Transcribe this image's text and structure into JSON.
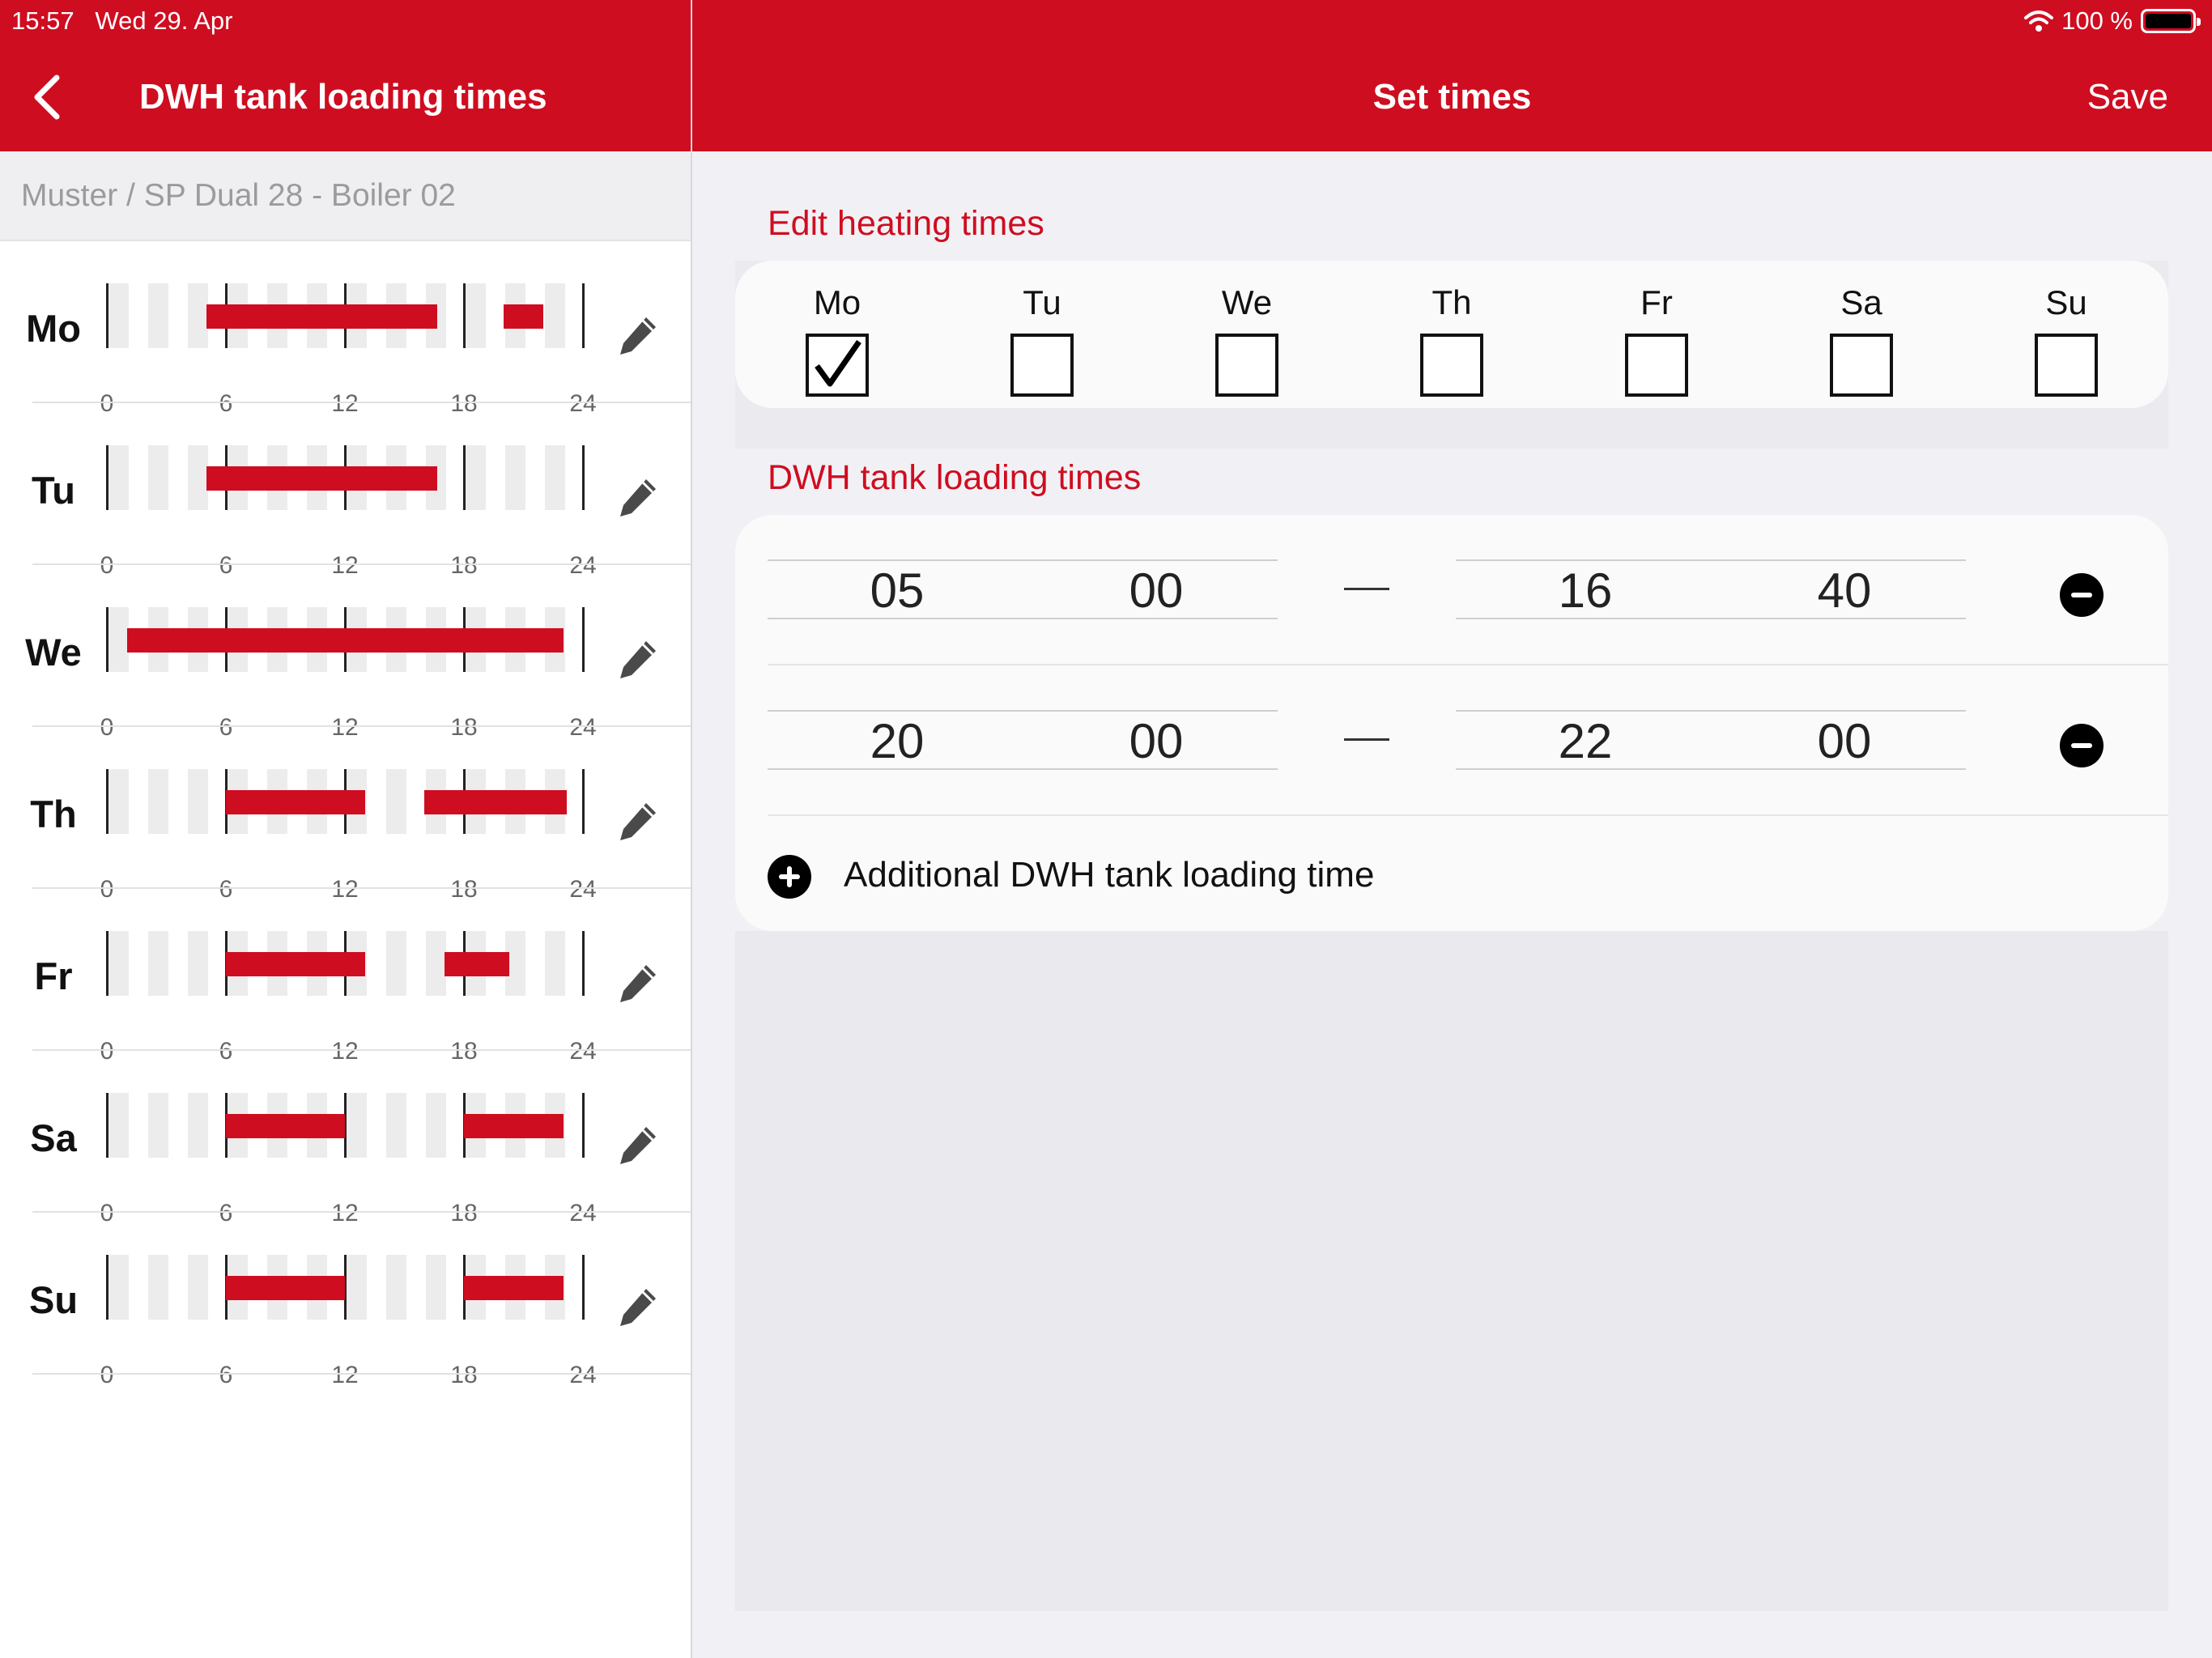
{
  "status_bar": {
    "time": "15:57",
    "date": "Wed 29. Apr",
    "battery": "100 %"
  },
  "left_header": {
    "title": "DWH tank loading times"
  },
  "right_header": {
    "title": "Set times",
    "save_label": "Save"
  },
  "breadcrumb": "Muster / SP Dual 28 - Boiler 02",
  "tick_labels": [
    "0",
    "6",
    "12",
    "18",
    "24"
  ],
  "schedule": [
    {
      "day": "Mo",
      "bars": [
        [
          5,
          16.67
        ],
        [
          20,
          22
        ]
      ]
    },
    {
      "day": "Tu",
      "bars": [
        [
          5,
          16.67
        ]
      ]
    },
    {
      "day": "We",
      "bars": [
        [
          1,
          23
        ]
      ]
    },
    {
      "day": "Th",
      "bars": [
        [
          6,
          13
        ],
        [
          16,
          23.2
        ]
      ]
    },
    {
      "day": "Fr",
      "bars": [
        [
          6,
          13
        ],
        [
          17,
          20.3
        ]
      ]
    },
    {
      "day": "Sa",
      "bars": [
        [
          6,
          12
        ],
        [
          18,
          23
        ]
      ]
    },
    {
      "day": "Su",
      "bars": [
        [
          6,
          12
        ],
        [
          18,
          23
        ]
      ]
    }
  ],
  "edit_heating": {
    "title": "Edit heating times",
    "days": [
      {
        "label": "Mo",
        "checked": true
      },
      {
        "label": "Tu",
        "checked": false
      },
      {
        "label": "We",
        "checked": false
      },
      {
        "label": "Th",
        "checked": false
      },
      {
        "label": "Fr",
        "checked": false
      },
      {
        "label": "Sa",
        "checked": false
      },
      {
        "label": "Su",
        "checked": false
      }
    ]
  },
  "loading_times": {
    "title": "DWH tank loading times",
    "entries": [
      {
        "start_hour": "05",
        "start_min": "00",
        "end_hour": "16",
        "end_min": "40"
      },
      {
        "start_hour": "20",
        "start_min": "00",
        "end_hour": "22",
        "end_min": "00"
      }
    ],
    "add_label": "Additional DWH tank loading time"
  },
  "colors": {
    "accent": "#cf0d20",
    "background": "#f1f1f5"
  }
}
